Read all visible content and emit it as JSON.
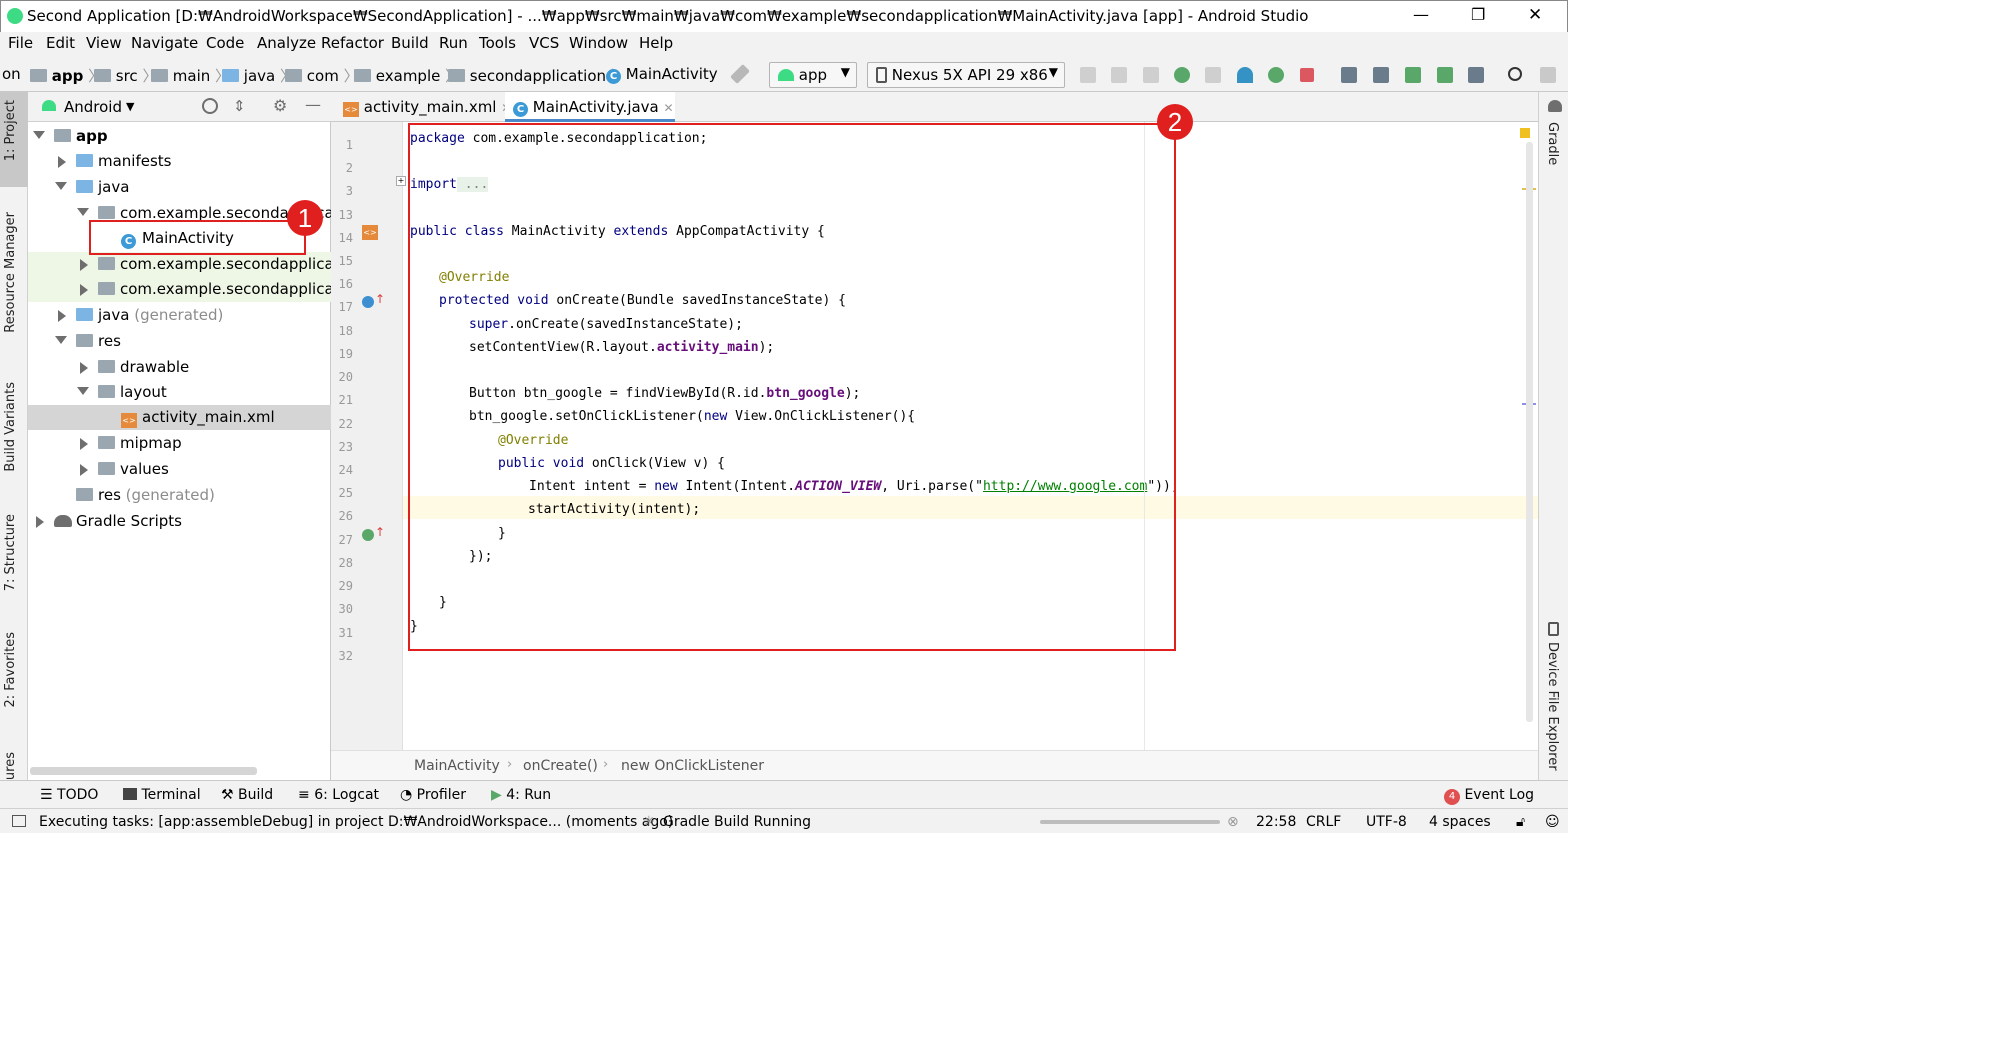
{
  "window": {
    "title": "Second Application [D:₩AndroidWorkspace₩SecondApplication] - ...₩app₩src₩main₩java₩com₩example₩secondapplication₩MainActivity.java [app] - Android Studio",
    "controls": [
      "—",
      "❐",
      "✕"
    ]
  },
  "menu": [
    "File",
    "Edit",
    "View",
    "Navigate",
    "Code",
    "Analyze",
    "Refactor",
    "Build",
    "Run",
    "Tools",
    "VCS",
    "Window",
    "Help"
  ],
  "breadcrumbs": [
    "on",
    "app",
    "src",
    "main",
    "java",
    "com",
    "example",
    "secondapplication",
    "MainActivity"
  ],
  "toolbar": {
    "run_config": "app",
    "device": "Nexus 5X API 29 x86"
  },
  "left_strip": [
    "1: Project",
    "Resource Manager",
    "Build Variants",
    "7: Structure",
    "2: Favorites",
    "ures"
  ],
  "right_strip": [
    "Gradle",
    "Device File Explorer"
  ],
  "project": {
    "view_mode": "Android",
    "tree": [
      {
        "label": "app"
      },
      {
        "label": "manifests"
      },
      {
        "label": "java"
      },
      {
        "label": "com.example.secondapplication"
      },
      {
        "label": "MainActivity"
      },
      {
        "label": "com.example.secondapplication"
      },
      {
        "label": "com.example.secondapplication"
      },
      {
        "label": "java",
        "suffix": "(generated)"
      },
      {
        "label": "res"
      },
      {
        "label": "drawable"
      },
      {
        "label": "layout"
      },
      {
        "label": "activity_main.xml"
      },
      {
        "label": "mipmap"
      },
      {
        "label": "values"
      },
      {
        "label": "res",
        "suffix": "(generated)"
      },
      {
        "label": "Gradle Scripts"
      }
    ]
  },
  "editor": {
    "tabs": [
      "activity_main.xml",
      "MainActivity.java"
    ],
    "active_tab": "MainActivity.java",
    "line_numbers": [
      "1",
      "2",
      "3",
      "13",
      "14",
      "15",
      "16",
      "17",
      "18",
      "19",
      "20",
      "21",
      "22",
      "23",
      "24",
      "25",
      "26",
      "27",
      "28",
      "29",
      "30",
      "31",
      "32"
    ],
    "code": {
      "l1_kw": "package",
      "l1_rest": " com.example.secondapplication;",
      "l3_kw": "import",
      "l3_rest": " ...",
      "l14_a": "public class",
      "l14_b": " MainActivity ",
      "l14_c": "extends",
      "l14_d": " AppCompatActivity {",
      "l16": "@Override",
      "l17_a": "protected void",
      "l17_b": " onCreate(Bundle savedInstanceState) {",
      "l18_a": "super",
      "l18_b": ".onCreate(savedInstanceState);",
      "l19_a": "setContentView(R.layout.",
      "l19_b": "activity_main",
      "l19_c": ");",
      "l21_a": "Button btn_google = findViewById(R.id.",
      "l21_b": "btn_google",
      "l21_c": ");",
      "l22_a": "btn_google.setOnClickListener(",
      "l22_b": "new",
      "l22_c": " View.OnClickListener(){",
      "l23": "@Override",
      "l24_a": "public void",
      "l24_b": " onClick(View v) {",
      "l25_a": "Intent intent = ",
      "l25_b": "new",
      "l25_c": " Intent(Intent.",
      "l25_d": "ACTION_VIEW",
      "l25_e": ", Uri.parse(\"",
      "l25_f": "http://www.google.com",
      "l25_g": "\"));",
      "l26": "startActivity(intent);",
      "l27": "}",
      "l28": "});",
      "l30": "}",
      "l31": "}"
    },
    "path": [
      "MainActivity",
      "onCreate()",
      "new OnClickListener"
    ]
  },
  "bottom_tools": [
    "TODO",
    "Terminal",
    "Build",
    "6: Logcat",
    "Profiler",
    "4: Run"
  ],
  "event_log": {
    "count": "4",
    "label": "Event Log"
  },
  "status": {
    "message": "Executing tasks: [app:assembleDebug] in project D:₩AndroidWorkspace... (moments ago)",
    "build": "Gradle Build Running",
    "position": "22:58",
    "line_sep": "CRLF",
    "encoding": "UTF-8",
    "indent": "4 spaces"
  },
  "callouts": [
    "1",
    "2"
  ],
  "colors": {
    "callout": "#e0201e",
    "keyword": "#000080",
    "annotation": "#808000",
    "field": "#660e7a",
    "string": "#008000"
  }
}
